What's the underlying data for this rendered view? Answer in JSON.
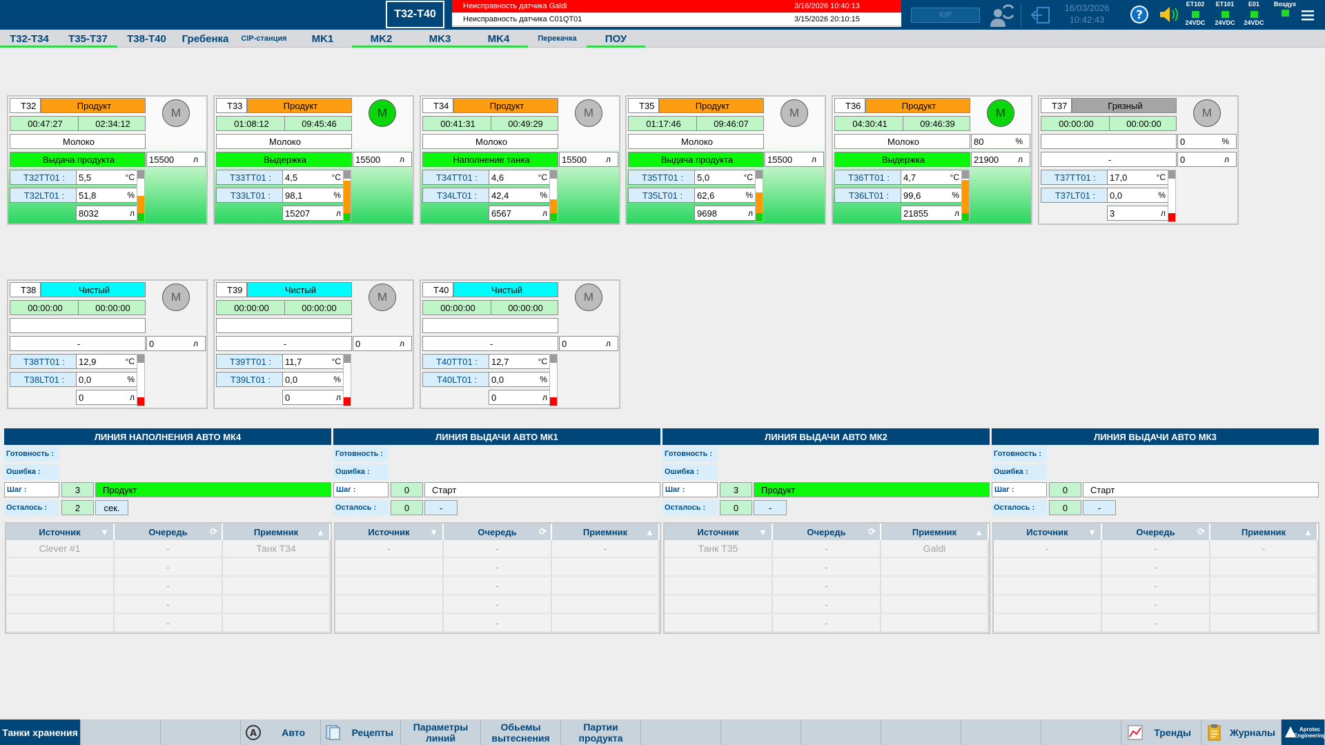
{
  "header": {
    "screen_title": "T32-T40",
    "kip_label": "KIP",
    "date": "16/03/2026",
    "time": "10:42:43",
    "alarms": [
      {
        "message": "Неисправность датчика Galdi",
        "time": "3/16/2026 10:40:13"
      },
      {
        "message": "Неисправность датчика C01QT01",
        "time": "3/15/2026 20:10:15"
      }
    ],
    "diagnostics": [
      {
        "name": "ET102",
        "sub": "24VDC"
      },
      {
        "name": "ET101",
        "sub": "24VDC"
      },
      {
        "name": "E01",
        "sub": "24VDC"
      },
      {
        "name": "Воздух",
        "sub": ""
      }
    ]
  },
  "nav": {
    "tabs": [
      "T32-T34",
      "T35-T37",
      "T38-T40",
      "Гребенка",
      "CIP-станция",
      "MK1",
      "MK2",
      "MK3",
      "MK4",
      "Перекачка",
      "ПОУ"
    ]
  },
  "tanks": [
    {
      "id": "T32",
      "status": "Продукт",
      "t1": "00:47:27",
      "t2": "02:34:12",
      "product": "Молоко",
      "product_pct": "",
      "pct_unit": "",
      "step": "Выдача продукта",
      "volume": "15500",
      "vol_unit": "л",
      "tt_tag": "T32TT01 :",
      "tt_val": "5,5",
      "tt_unit": "°C",
      "lt_tag": "T32LT01 :",
      "lt_val": "51,8",
      "lt_unit": "%",
      "level": "8032",
      "level_unit": "л",
      "motor": "M",
      "motor_on": false,
      "level_color": "#ff9900"
    },
    {
      "id": "T33",
      "status": "Продукт",
      "t1": "01:08:12",
      "t2": "09:45:46",
      "product": "Молоко",
      "product_pct": "",
      "pct_unit": "",
      "step": "Выдержка",
      "volume": "15500",
      "vol_unit": "л",
      "tt_tag": "T33TT01 :",
      "tt_val": "4,5",
      "tt_unit": "°C",
      "lt_tag": "T33LT01 :",
      "lt_val": "98,1",
      "lt_unit": "%",
      "level": "15207",
      "level_unit": "л",
      "motor": "M",
      "motor_on": true,
      "level_color": "#ff9900"
    },
    {
      "id": "T34",
      "status": "Продукт",
      "t1": "00:41:31",
      "t2": "00:49:29",
      "product": "Молоко",
      "product_pct": "",
      "pct_unit": "",
      "step": "Наполнение танка",
      "volume": "15500",
      "vol_unit": "л",
      "tt_tag": "T34TT01 :",
      "tt_val": "4,6",
      "tt_unit": "°C",
      "lt_tag": "T34LT01 :",
      "lt_val": "42,4",
      "lt_unit": "%",
      "level": "6567",
      "level_unit": "л",
      "motor": "M",
      "motor_on": false,
      "level_color": "#ff9900"
    },
    {
      "id": "T35",
      "status": "Продукт",
      "t1": "01:17:46",
      "t2": "09:46:07",
      "product": "Молоко",
      "product_pct": "",
      "pct_unit": "",
      "step": "Выдача продукта",
      "volume": "15500",
      "vol_unit": "л",
      "tt_tag": "T35TT01 :",
      "tt_val": "5,0",
      "tt_unit": "°C",
      "lt_tag": "T35LT01 :",
      "lt_val": "62,6",
      "lt_unit": "%",
      "level": "9698",
      "level_unit": "л",
      "motor": "M",
      "motor_on": false,
      "level_color": "#ff9900"
    },
    {
      "id": "T36",
      "status": "Продукт",
      "t1": "04:30:41",
      "t2": "09:46:39",
      "product": "Молоко",
      "product_pct": "80",
      "pct_unit": "%",
      "step": "Выдержка",
      "volume": "21900",
      "vol_unit": "л",
      "tt_tag": "T36TT01 :",
      "tt_val": "4,7",
      "tt_unit": "°C",
      "lt_tag": "T36LT01 :",
      "lt_val": "99,6",
      "lt_unit": "%",
      "level": "21855",
      "level_unit": "л",
      "motor": "M",
      "motor_on": true,
      "level_color": "#ff9900"
    },
    {
      "id": "T37",
      "status": "Грязный",
      "t1": "00:00:00",
      "t2": "00:00:00",
      "product": "",
      "product_pct": "0",
      "pct_unit": "%",
      "step": "-",
      "volume": "0",
      "vol_unit": "л",
      "tt_tag": "T37TT01 :",
      "tt_val": "17,0",
      "tt_unit": "°C",
      "lt_tag": "T37LT01 :",
      "lt_val": "0,0",
      "lt_unit": "%",
      "level": "3",
      "level_unit": "л",
      "motor": "M",
      "motor_on": false,
      "level_color": "#ff0000"
    },
    {
      "id": "T38",
      "status": "Чистый",
      "t1": "00:00:00",
      "t2": "00:00:00",
      "product": "",
      "product_pct": "",
      "pct_unit": "",
      "step": "-",
      "volume": "0",
      "vol_unit": "л",
      "tt_tag": "T38TT01 :",
      "tt_val": "12,9",
      "tt_unit": "°C",
      "lt_tag": "T38LT01 :",
      "lt_val": "0,0",
      "lt_unit": "%",
      "level": "0",
      "level_unit": "л",
      "motor": "M",
      "motor_on": false,
      "level_color": "#ff0000"
    },
    {
      "id": "T39",
      "status": "Чистый",
      "t1": "00:00:00",
      "t2": "00:00:00",
      "product": "",
      "product_pct": "",
      "pct_unit": "",
      "step": "-",
      "volume": "0",
      "vol_unit": "л",
      "tt_tag": "T39TT01 :",
      "tt_val": "11,7",
      "tt_unit": "°C",
      "lt_tag": "T39LT01 :",
      "lt_val": "0,0",
      "lt_unit": "%",
      "level": "0",
      "level_unit": "л",
      "motor": "M",
      "motor_on": false,
      "level_color": "#ff0000"
    },
    {
      "id": "T40",
      "status": "Чистый",
      "t1": "00:00:00",
      "t2": "00:00:00",
      "product": "",
      "product_pct": "",
      "pct_unit": "",
      "step": "-",
      "volume": "0",
      "vol_unit": "л",
      "tt_tag": "T40TT01 :",
      "tt_val": "12,7",
      "tt_unit": "°C",
      "lt_tag": "T40LT01 :",
      "lt_val": "0,0",
      "lt_unit": "%",
      "level": "0",
      "level_unit": "л",
      "motor": "M",
      "motor_on": false,
      "level_color": "#ff0000"
    }
  ],
  "lines": [
    {
      "title": "ЛИНИЯ НАПОЛНЕНИЯ АВТО МК4",
      "ready_label": "Готовность :",
      "error_label": "Ошибка :",
      "step_label": "Шаг :",
      "remain_label": "Осталось :",
      "step_num": "3",
      "step_name": "Продукт",
      "step_active": true,
      "remain_val": "2",
      "remain_unit": "сек.",
      "cols": [
        "Источник",
        "Очередь",
        "Приемник"
      ],
      "rows": [
        [
          "Clever #1",
          "-",
          "Танк T34"
        ],
        [
          "",
          "-",
          ""
        ],
        [
          "",
          "-",
          ""
        ],
        [
          "",
          "-",
          ""
        ],
        [
          "",
          "-",
          ""
        ]
      ]
    },
    {
      "title": "ЛИНИЯ ВЫДАЧИ АВТО МК1",
      "ready_label": "Готовность :",
      "error_label": "Ошибка :",
      "step_label": "Шаг :",
      "remain_label": "Осталось :",
      "step_num": "0",
      "step_name": "Старт",
      "step_active": false,
      "remain_val": "0",
      "remain_unit": "-",
      "cols": [
        "Источник",
        "Очередь",
        "Приемник"
      ],
      "rows": [
        [
          "-",
          "-",
          "-"
        ],
        [
          "",
          "-",
          ""
        ],
        [
          "",
          "-",
          ""
        ],
        [
          "",
          "-",
          ""
        ],
        [
          "",
          "-",
          ""
        ]
      ]
    },
    {
      "title": "ЛИНИЯ ВЫДАЧИ АВТО МК2",
      "ready_label": "Готовность :",
      "error_label": "Ошибка :",
      "step_label": "Шаг :",
      "remain_label": "Осталось :",
      "step_num": "3",
      "step_name": "Продукт",
      "step_active": true,
      "remain_val": "0",
      "remain_unit": "-",
      "cols": [
        "Источник",
        "Очередь",
        "Приемник"
      ],
      "rows": [
        [
          "Танк T35",
          "-",
          "Galdi"
        ],
        [
          "",
          "-",
          ""
        ],
        [
          "",
          "-",
          ""
        ],
        [
          "",
          "-",
          ""
        ],
        [
          "",
          "-",
          ""
        ]
      ]
    },
    {
      "title": "ЛИНИЯ ВЫДАЧИ АВТО МК3",
      "ready_label": "Готовность :",
      "error_label": "Ошибка :",
      "step_label": "Шаг :",
      "remain_label": "Осталось :",
      "step_num": "0",
      "step_name": "Старт",
      "step_active": false,
      "remain_val": "0",
      "remain_unit": "-",
      "cols": [
        "Источник",
        "Очередь",
        "Приемник"
      ],
      "rows": [
        [
          "-",
          "-",
          "-"
        ],
        [
          "",
          "-",
          ""
        ],
        [
          "",
          "-",
          ""
        ],
        [
          "",
          "-",
          ""
        ],
        [
          "",
          "-",
          ""
        ]
      ]
    }
  ],
  "footer": {
    "buttons": [
      "Танки хранения",
      "",
      "",
      "Авто",
      "Рецепты",
      "Параметры линий",
      "Обьемы вытеснения",
      "Партии продукта",
      "",
      "",
      "",
      "",
      "",
      "",
      "Тренды",
      "Журналы",
      ""
    ],
    "logo_text": "Aprotec Engineering"
  },
  "colors": {
    "header": "#004679",
    "alarm_active": "#ff0000",
    "product": "#fd9d12",
    "clean": "#00fbfd",
    "dirty": "#a5a5a5",
    "active_step": "#0bf70b"
  },
  "icons": [
    "user-switch-icon",
    "logout-icon",
    "help-icon",
    "sound-icon",
    "menu-icon",
    "auto-icon",
    "recipes-icon",
    "trends-icon",
    "journals-icon"
  ]
}
